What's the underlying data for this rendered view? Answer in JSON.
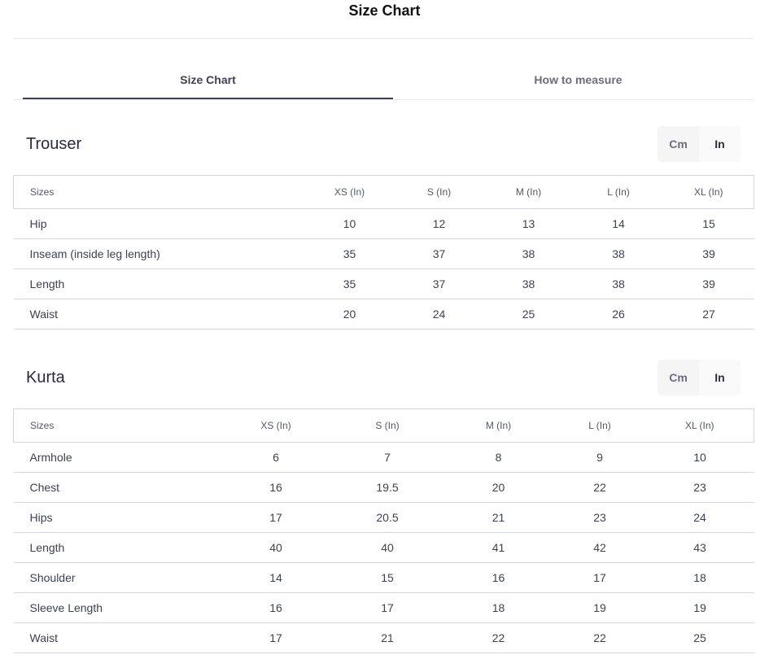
{
  "header": {
    "title": "Size Chart"
  },
  "tabs": [
    {
      "label": "Size Chart",
      "active": true
    },
    {
      "label": "How to measure",
      "active": false
    }
  ],
  "units": {
    "cm": "Cm",
    "in": "In",
    "selected": "In"
  },
  "trouser": {
    "title": "Trouser",
    "headers": [
      "Sizes",
      "XS (In)",
      "S (In)",
      "M (In)",
      "L (In)",
      "XL (In)"
    ],
    "rows": [
      [
        "Hip",
        "10",
        "12",
        "13",
        "14",
        "15"
      ],
      [
        "Inseam (inside leg length)",
        "35",
        "37",
        "38",
        "38",
        "39"
      ],
      [
        "Length",
        "35",
        "37",
        "38",
        "38",
        "39"
      ],
      [
        "Waist",
        "20",
        "24",
        "25",
        "26",
        "27"
      ]
    ]
  },
  "kurta": {
    "title": "Kurta",
    "headers": [
      "Sizes",
      "XS (In)",
      "S (In)",
      "M (In)",
      "L (In)",
      "XL (In)"
    ],
    "rows": [
      [
        "Armhole",
        "6",
        "7",
        "8",
        "9",
        "10"
      ],
      [
        "Chest",
        "16",
        "19.5",
        "20",
        "22",
        "23"
      ],
      [
        "Hips",
        "17",
        "20.5",
        "21",
        "23",
        "24"
      ],
      [
        "Length",
        "40",
        "40",
        "41",
        "42",
        "43"
      ],
      [
        "Shoulder",
        "14",
        "15",
        "16",
        "17",
        "18"
      ],
      [
        "Sleeve Length",
        "16",
        "17",
        "18",
        "19",
        "19"
      ],
      [
        "Waist",
        "17",
        "21",
        "22",
        "22",
        "25"
      ]
    ]
  },
  "colors": {
    "text": "#282c3f",
    "border": "#d4d5d9",
    "active_tab": "#3e4152",
    "muted": "#696e79"
  }
}
